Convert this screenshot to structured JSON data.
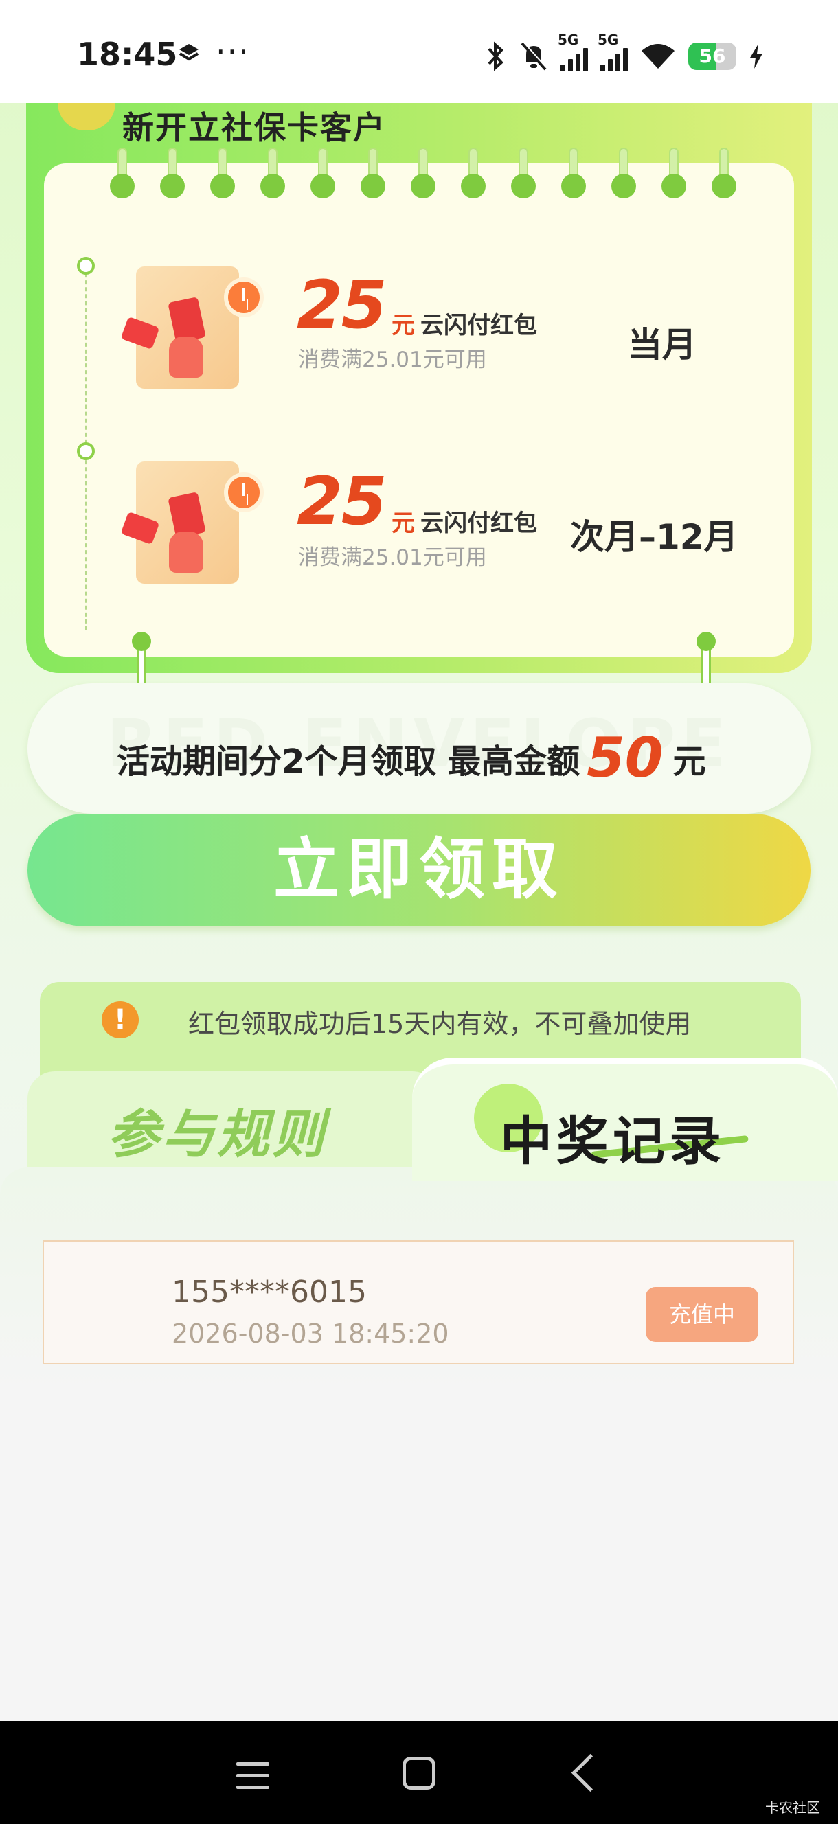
{
  "status_bar": {
    "time": "18:45",
    "more": "···",
    "network_1": "5G",
    "network_2": "5G",
    "battery": "56"
  },
  "card": {
    "title": "新开立社保卡客户",
    "rewards": [
      {
        "amount": "25",
        "unit": "元",
        "type": "云闪付红包",
        "condition": "消费满25.01元可用",
        "period": "当月"
      },
      {
        "amount": "25",
        "unit": "元",
        "type": "云闪付红包",
        "condition": "消费满25.01元可用",
        "period": "次月–12月"
      }
    ]
  },
  "summary": {
    "text_before": "活动期间分2个月领取  最高金额",
    "amount": "50",
    "unit": "元",
    "background_text": "RED ENVELOPE"
  },
  "claim_button": {
    "label": "立即领取"
  },
  "notice": {
    "icon": "!",
    "text": "红包领取成功后15天内有效，不可叠加使用"
  },
  "tabs": {
    "rules": "参与规则",
    "records": "中奖记录"
  },
  "records": [
    {
      "phone": "155****6015",
      "time": "2026-08-03 18:45:20",
      "status": "充值中"
    }
  ],
  "watermark": "卡农社区",
  "icons": [
    "layers-icon",
    "bluetooth-icon",
    "mute-bell-icon",
    "signal-icon",
    "wifi-icon",
    "battery-icon",
    "charging-icon",
    "warning-icon",
    "menu-icon",
    "home-icon",
    "back-icon"
  ],
  "colors": {
    "accent_green": "#8fd14a",
    "amount_red": "#e5491e",
    "status_orange": "#f6a67f"
  }
}
